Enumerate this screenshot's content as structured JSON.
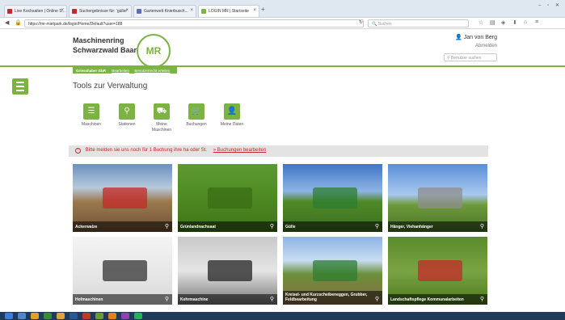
{
  "browser": {
    "tabs": [
      {
        "label": "Live Kochsaiten | Online S...",
        "color": "#c62828"
      },
      {
        "label": "Suchergebnisse für: 'güller'",
        "color": "#c62828"
      },
      {
        "label": "Gartenwelt Knierbusch...",
        "color": "#5c6bc0"
      },
      {
        "label": "LOGIN MR | Startseite",
        "color": "#7cb342"
      }
    ],
    "url": "https://mr-mietpark.de/login/Home/Default?user=188",
    "search_placeholder": "Suchen",
    "window_buttons": "– ▫ ✕"
  },
  "header": {
    "brand_line1": "Maschinenring",
    "brand_line2": "Schwarzwald Baar",
    "logo_text": "MR",
    "user_name": "Jan von Berg",
    "logout": "Abmelden",
    "user_search_placeholder": "Benutzer suchen"
  },
  "subnav": {
    "active": "Griesshaber GbR",
    "links": [
      "Bearbeiten",
      "Benutzerrecht erteilen"
    ]
  },
  "main": {
    "title": "Tools zur Verwaltung",
    "tools": [
      {
        "label": "Maschinen",
        "icon": "list-icon",
        "glyph": "☰"
      },
      {
        "label": "Stationen",
        "icon": "location-pin-icon",
        "glyph": "⚲"
      },
      {
        "label": "Meine\nMaschinen",
        "icon": "tractor-icon",
        "glyph": "⛟"
      },
      {
        "label": "Buchungen",
        "icon": "cart-icon",
        "glyph": "🛒"
      },
      {
        "label": "Meine Daten",
        "icon": "user-icon",
        "glyph": "👤"
      }
    ],
    "alert_text": "Bitte melden sie uns noch für 1 Buchung ihre ha oder St.",
    "alert_link": "» Buchungen bearbeiten"
  },
  "tiles": [
    {
      "label": "Ackerwalze",
      "bg": "linear-gradient(#6b8fbf 0%, #b7c9dc 35%, #9c7a4e 55%, #6e5236 100%)",
      "accent": "#c62828"
    },
    {
      "label": "Grünlandnachsaat",
      "bg": "linear-gradient(#5c9a2e 0%, #4e8a22 50%, #3f7318 100%)",
      "accent": "#3a6e14"
    },
    {
      "label": "Gülle",
      "bg": "linear-gradient(#3f75c4 0%, #8eb4e4 40%, #4f8a2a 55%, #3c6e1c 100%)",
      "accent": "#2e7d32"
    },
    {
      "label": "Hänger, Viehanhänger",
      "bg": "linear-gradient(#5a8fd6 0%, #a9c8ee 45%, #6e9a3c 60%, #4a7428 100%)",
      "accent": "#8e8e8e"
    },
    {
      "label": "Hofmaschinen",
      "bg": "linear-gradient(#f4f4f4 0%, #e8e8e8 50%, #d9d9d9 100%)",
      "accent": "#333"
    },
    {
      "label": "Kehrmaschine",
      "bg": "linear-gradient(#c9c9c9 0%, #e5e5e5 50%, #777 100%)",
      "accent": "#222"
    },
    {
      "label": "Kreisel- und Kurzscheibeneggen, Grubber, Feldbearbeitung",
      "bg": "linear-gradient(#8eb4e4 0%, #c7dcf2 35%, #6b8f3a 55%, #8a6a44 100%)",
      "accent": "#2e7d32"
    },
    {
      "label": "Landschaftspflege Kommunalarbeiten",
      "bg": "linear-gradient(#5a8a2a 0%, #7aa444 50%, #4c7a20 100%)",
      "accent": "#c62828"
    }
  ],
  "colors": {
    "accent": "#7cb342",
    "alert": "#c62828"
  }
}
